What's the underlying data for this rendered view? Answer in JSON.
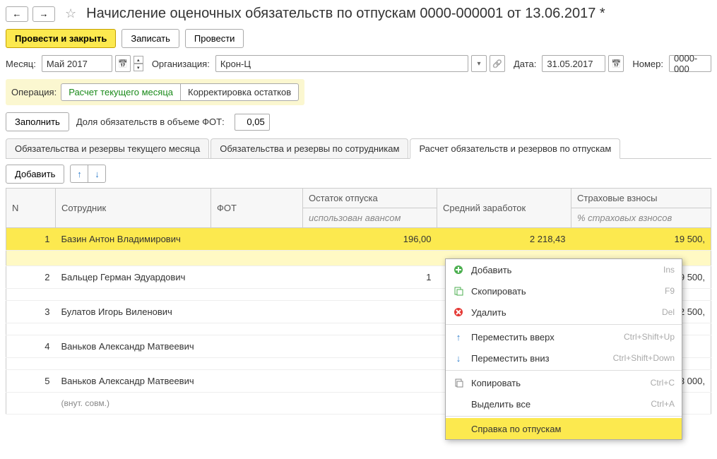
{
  "title": "Начисление оценочных обязательств по отпускам 0000-000001 от 13.06.2017 *",
  "toolbar": {
    "post_close": "Провести и закрыть",
    "save": "Записать",
    "post": "Провести"
  },
  "form": {
    "month_label": "Месяц:",
    "month": "Май 2017",
    "org_label": "Организация:",
    "org": "Крон-Ц",
    "date_label": "Дата:",
    "date": "31.05.2017",
    "number_label": "Номер:",
    "number": "0000-000"
  },
  "operation": {
    "label": "Операция:",
    "op1": "Расчет текущего месяца",
    "op2": "Корректировка остатков"
  },
  "fill": {
    "button": "Заполнить",
    "share_label": "Доля обязательств в объеме ФОТ:",
    "share_value": "0,05"
  },
  "tabs": {
    "t1": "Обязательства и резервы текущего месяца",
    "t2": "Обязательства и резервы по сотрудникам",
    "t3": "Расчет обязательств и резервов по отпускам"
  },
  "table_btns": {
    "add": "Добавить"
  },
  "columns": {
    "n": "N",
    "employee": "Сотрудник",
    "fot": "ФОТ",
    "vacation": "Остаток отпуска",
    "vacation_sub": "использован авансом",
    "avg": "Средний заработок",
    "insurance": "Страховые взносы",
    "insurance_sub": "% страховых взносов"
  },
  "rows": [
    {
      "n": "1",
      "employee": "Базин Антон Владимирович",
      "vacation": "196,00",
      "avg": "2 218,43",
      "insurance": "19 500,"
    },
    {
      "n": "2",
      "employee": "Бальцер Герман Эдуардович",
      "vacation": "1",
      "avg": "",
      "insurance": "19 500,"
    },
    {
      "n": "3",
      "employee": "Булатов Игорь Виленович",
      "vacation": "",
      "avg": "",
      "insurance": "22 500,"
    },
    {
      "n": "4",
      "employee": "Ваньков Александр Матвеевич",
      "vacation": "",
      "avg": "",
      "insurance": ""
    },
    {
      "n": "5",
      "employee": "Ваньков Александр Матвеевич",
      "sub": "(внут. совм.)",
      "vacation": "",
      "avg": "",
      "insurance": "3 000,"
    }
  ],
  "ctx": {
    "add": "Добавить",
    "add_sc": "Ins",
    "copy": "Скопировать",
    "copy_sc": "F9",
    "delete": "Удалить",
    "delete_sc": "Del",
    "up": "Переместить вверх",
    "up_sc": "Ctrl+Shift+Up",
    "down": "Переместить вниз",
    "down_sc": "Ctrl+Shift+Down",
    "clipboard": "Копировать",
    "clipboard_sc": "Ctrl+C",
    "select_all": "Выделить все",
    "select_all_sc": "Ctrl+A",
    "report": "Справка по отпускам"
  }
}
